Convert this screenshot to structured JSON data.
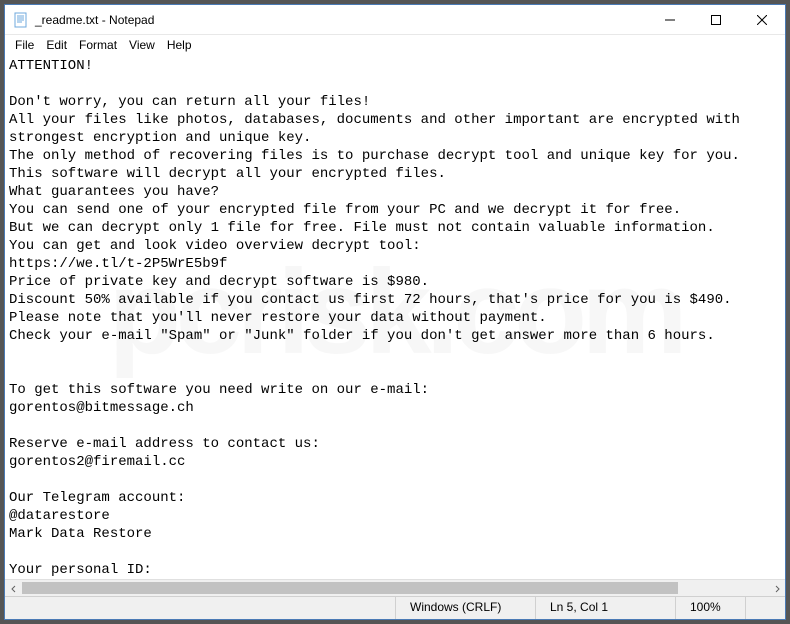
{
  "window": {
    "title": "_readme.txt - Notepad"
  },
  "menubar": {
    "items": [
      "File",
      "Edit",
      "Format",
      "View",
      "Help"
    ]
  },
  "editor": {
    "content": "ATTENTION!\n\nDon't worry, you can return all your files!\nAll your files like photos, databases, documents and other important are encrypted with\nstrongest encryption and unique key.\nThe only method of recovering files is to purchase decrypt tool and unique key for you.\nThis software will decrypt all your encrypted files.\nWhat guarantees you have?\nYou can send one of your encrypted file from your PC and we decrypt it for free.\nBut we can decrypt only 1 file for free. File must not contain valuable information.\nYou can get and look video overview decrypt tool:\nhttps://we.tl/t-2P5WrE5b9f\nPrice of private key and decrypt software is $980.\nDiscount 50% available if you contact us first 72 hours, that's price for you is $490.\nPlease note that you'll never restore your data without payment.\nCheck your e-mail \"Spam\" or \"Junk\" folder if you don't get answer more than 6 hours.\n\n\nTo get this software you need write on our e-mail:\ngorentos@bitmessage.ch\n\nReserve e-mail address to contact us:\ngorentos2@firemail.cc\n\nOur Telegram account:\n@datarestore\nMark Data Restore\n\nYour personal ID:\n-"
  },
  "statusbar": {
    "line_ending": "Windows (CRLF)",
    "cursor": "Ln 5, Col 1",
    "zoom": "100%"
  },
  "watermark": "pcrisk.com"
}
